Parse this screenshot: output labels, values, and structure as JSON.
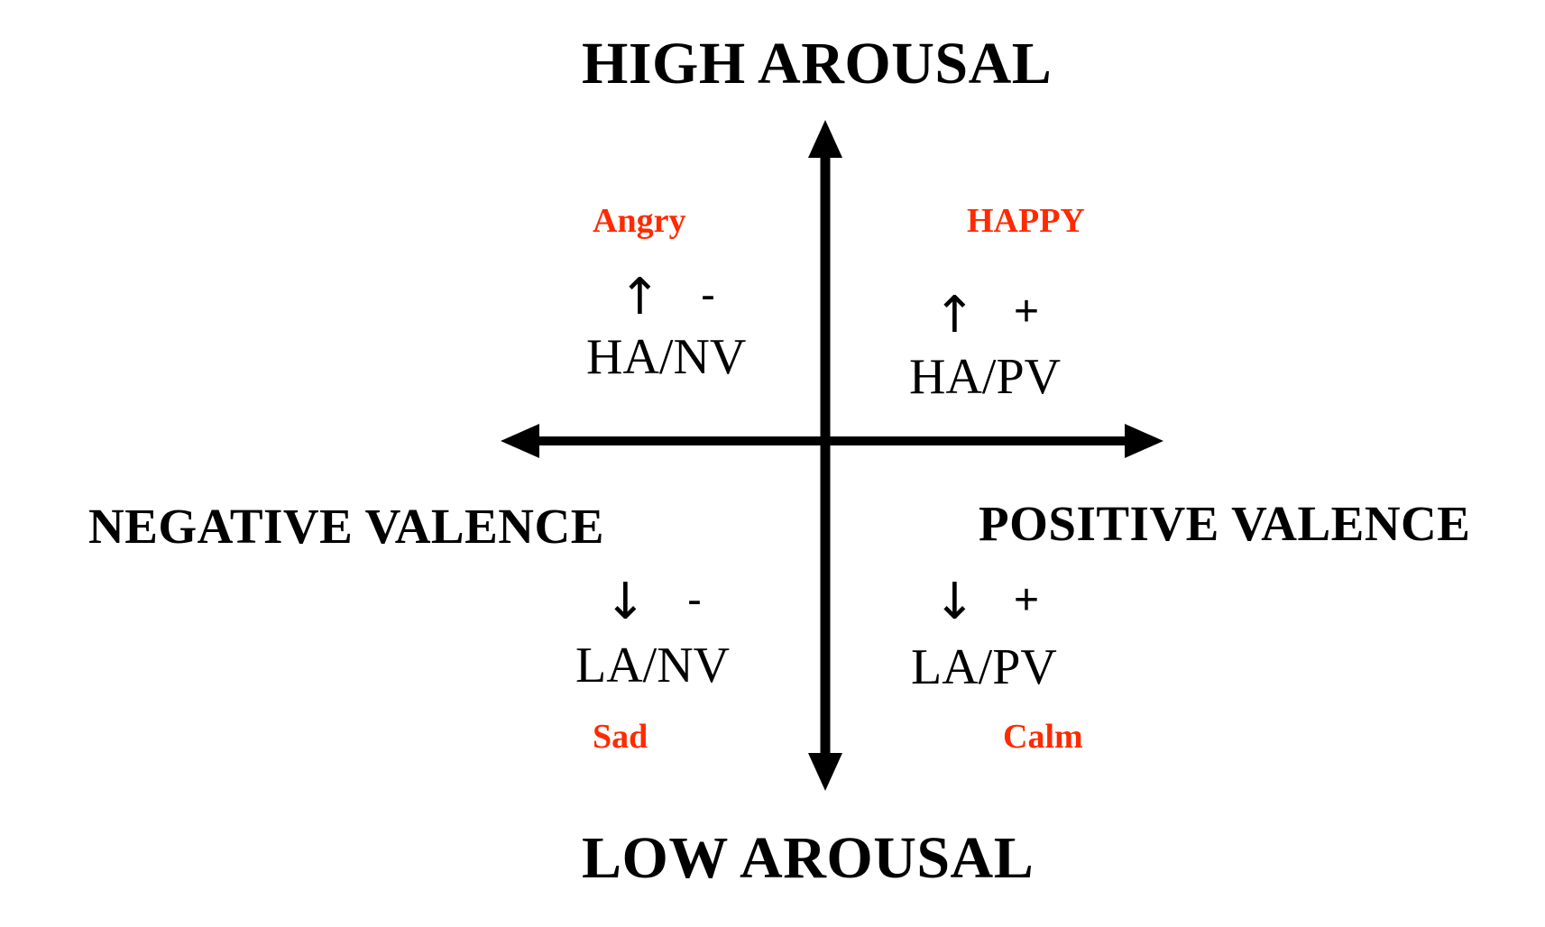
{
  "axes": {
    "top": "HIGH AROUSAL",
    "bottom": "LOW AROUSAL",
    "left": "NEGATIVE VALENCE",
    "right": "POSITIVE VALENCE"
  },
  "quadrants": {
    "top_left": {
      "emotion": "Angry",
      "arousal_symbol": "↑",
      "valence_sign": "-",
      "code": "HA/NV"
    },
    "top_right": {
      "emotion": "HAPPY",
      "arousal_symbol": "↑",
      "valence_sign": "+",
      "code": "HA/PV"
    },
    "bottom_left": {
      "emotion": "Sad",
      "arousal_symbol": "↓",
      "valence_sign": "-",
      "code": "LA/NV"
    },
    "bottom_right": {
      "emotion": "Calm",
      "arousal_symbol": "↓",
      "valence_sign": "+",
      "code": "LA/PV"
    }
  },
  "colors": {
    "emotion_label": "#ff2a00",
    "axis": "#000000"
  }
}
